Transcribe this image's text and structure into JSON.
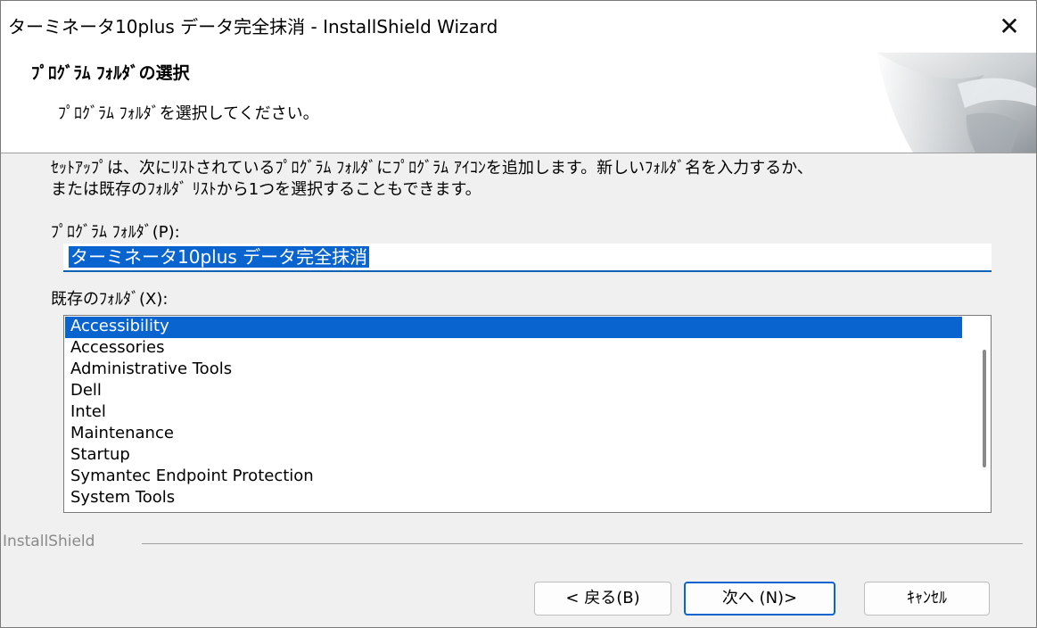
{
  "window": {
    "title": "ターミネータ10plus データ完全抹消 - InstallShield Wizard",
    "close_glyph": "✕"
  },
  "header": {
    "title": "ﾌﾟﾛｸﾞﾗﾑ ﾌｫﾙﾀﾞの選択",
    "subtitle": "ﾌﾟﾛｸﾞﾗﾑ ﾌｫﾙﾀﾞを選択してください。",
    "graphic_icon": "page-curl-icon"
  },
  "body": {
    "description": "ｾｯﾄｱｯﾌﾟは、次にﾘｽﾄされているﾌﾟﾛｸﾞﾗﾑ ﾌｫﾙﾀﾞにﾌﾟﾛｸﾞﾗﾑ ｱｲｺﾝを追加します。新しいﾌｫﾙﾀﾞ名を入力するか、\nまたは既存のﾌｫﾙﾀﾞ ﾘｽﾄから1つを選択することもできます。",
    "program_folder_label": "ﾌﾟﾛｸﾞﾗﾑ ﾌｫﾙﾀﾞ(P):",
    "program_folder_value": "ターミネータ10plus データ完全抹消",
    "existing_folders_label": "既存のﾌｫﾙﾀﾞ(X):",
    "existing_folders": [
      "Accessibility",
      "Accessories",
      "Administrative Tools",
      "Dell",
      "Intel",
      "Maintenance",
      "Startup",
      "Symantec Endpoint Protection",
      "System Tools"
    ],
    "selected_folder": "Accessibility"
  },
  "footer": {
    "brand": "InstallShield",
    "back_label": "< 戻る(B)",
    "next_label": "次へ (N)>",
    "cancel_label": "ｷｬﾝｾﾙ"
  },
  "colors": {
    "selection": "#0a64d0",
    "accent_border": "#0f62b5",
    "background": "#f0f0f0"
  }
}
